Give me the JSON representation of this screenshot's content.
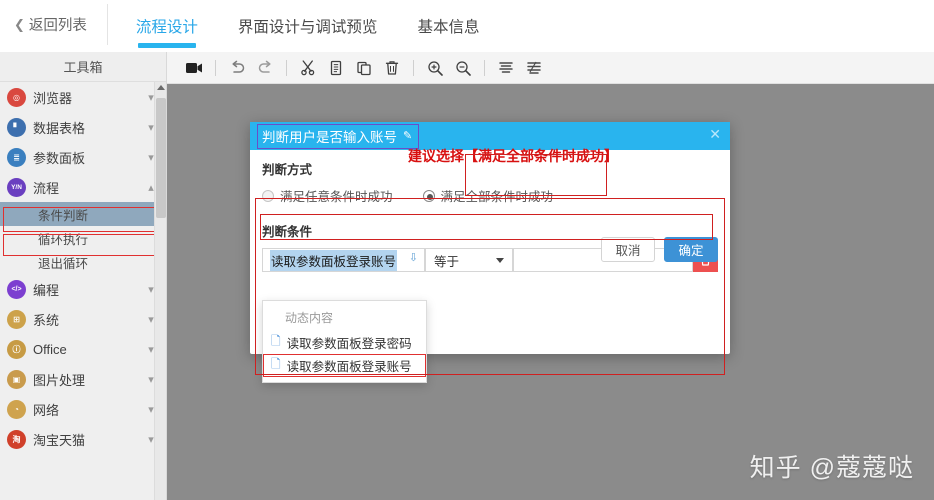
{
  "topbar": {
    "back_label": "返回列表",
    "back_chevron": "chevron-left-icon",
    "tabs": [
      {
        "label": "流程设计",
        "active": true
      },
      {
        "label": "界面设计与调试预览",
        "active": false
      },
      {
        "label": "基本信息",
        "active": false
      }
    ]
  },
  "sidebar": {
    "title": "工具箱",
    "items": [
      {
        "label": "浏览器",
        "icon": "compass-icon",
        "icon_text": "◎",
        "color": "#d9483f",
        "expanded": false
      },
      {
        "label": "数据表格",
        "icon": "chart-icon",
        "icon_text": "▐",
        "color": "#3d6fae",
        "expanded": false
      },
      {
        "label": "参数面板",
        "icon": "panel-icon",
        "icon_text": "≣",
        "color": "#3a7fbf",
        "expanded": false
      },
      {
        "label": "流程",
        "icon": "yes-no-icon",
        "icon_text": "Y/N",
        "color": "#6a3fc0",
        "expanded": true,
        "children": [
          {
            "label": "条件判断",
            "selected": true
          },
          {
            "label": "循环执行",
            "selected": false
          },
          {
            "label": "退出循环",
            "selected": false
          }
        ]
      },
      {
        "label": "编程",
        "icon": "code-icon",
        "icon_text": "</>",
        "color": "#7c3fd0",
        "expanded": false
      },
      {
        "label": "系统",
        "icon": "grid-icon",
        "icon_text": "⊞",
        "color": "#cda24a",
        "expanded": false
      },
      {
        "label": "Office",
        "icon": "office-icon",
        "icon_text": "ⓘ",
        "color": "#c79b44",
        "expanded": false
      },
      {
        "label": "图片处理",
        "icon": "image-icon",
        "icon_text": "▣",
        "color": "#c99b4c",
        "expanded": false
      },
      {
        "label": "网络",
        "icon": "network-icon",
        "icon_text": "◔",
        "color": "#cfa34e",
        "expanded": false
      },
      {
        "label": "淘宝天猫",
        "icon": "taobao-icon",
        "icon_text": "淘",
        "color": "#d0402a",
        "expanded": false
      }
    ],
    "scrollbar": {
      "up_arrow": "scroll-up-arrow-icon"
    }
  },
  "toolbar": {
    "buttons": [
      {
        "name": "record-button",
        "glyph": "▶"
      },
      {
        "name": "undo-button",
        "glyph": "↶"
      },
      {
        "name": "redo-button",
        "glyph": "↷"
      },
      {
        "name": "cut-button",
        "glyph": "✂"
      },
      {
        "name": "copy-button",
        "glyph": "Ὄ4"
      },
      {
        "name": "paste-button",
        "glyph": "⎘"
      },
      {
        "name": "delete-button",
        "glyph": "Ὕ1"
      },
      {
        "name": "zoom-in-button",
        "glyph": "+"
      },
      {
        "name": "zoom-out-button",
        "glyph": "−"
      },
      {
        "name": "align-top-button",
        "glyph": "≡"
      },
      {
        "name": "align-layer-button",
        "glyph": "≣"
      }
    ]
  },
  "dialog": {
    "title": "判断用户是否输入账号",
    "edit_icon": "edit-pencil-icon",
    "close_icon": "close-icon",
    "mode_section_label": "判断方式",
    "mode_options": [
      {
        "label": "满足任意条件时成功",
        "checked": false
      },
      {
        "label": "满足全部条件时成功",
        "checked": true
      }
    ],
    "annotation": "建议选择【满足全部条件时成功】",
    "condition_section_label": "判断条件",
    "condition_row": {
      "left_value": "读取参数面板登录账号",
      "operator_value": "等于",
      "right_value": "",
      "delete_icon": "trash-icon",
      "expand_icon": "chevron-double-down-icon"
    },
    "dropdown": {
      "group_label": "动态内容",
      "items": [
        {
          "label": "读取参数面板登录密码",
          "icon": "variable-icon",
          "highlighted": false
        },
        {
          "label": "读取参数面板登录账号",
          "icon": "variable-icon",
          "highlighted": true
        }
      ]
    },
    "cancel_label": "取消",
    "confirm_label": "确定"
  },
  "watermark": "知乎 @蔻蔻哒",
  "colors": {
    "accent_blue": "#29b4ee",
    "primary_button": "#3d92d6",
    "annotation_red": "#d02020",
    "delete_red": "#ed5050",
    "selection_blue": "#b3d4ef"
  }
}
